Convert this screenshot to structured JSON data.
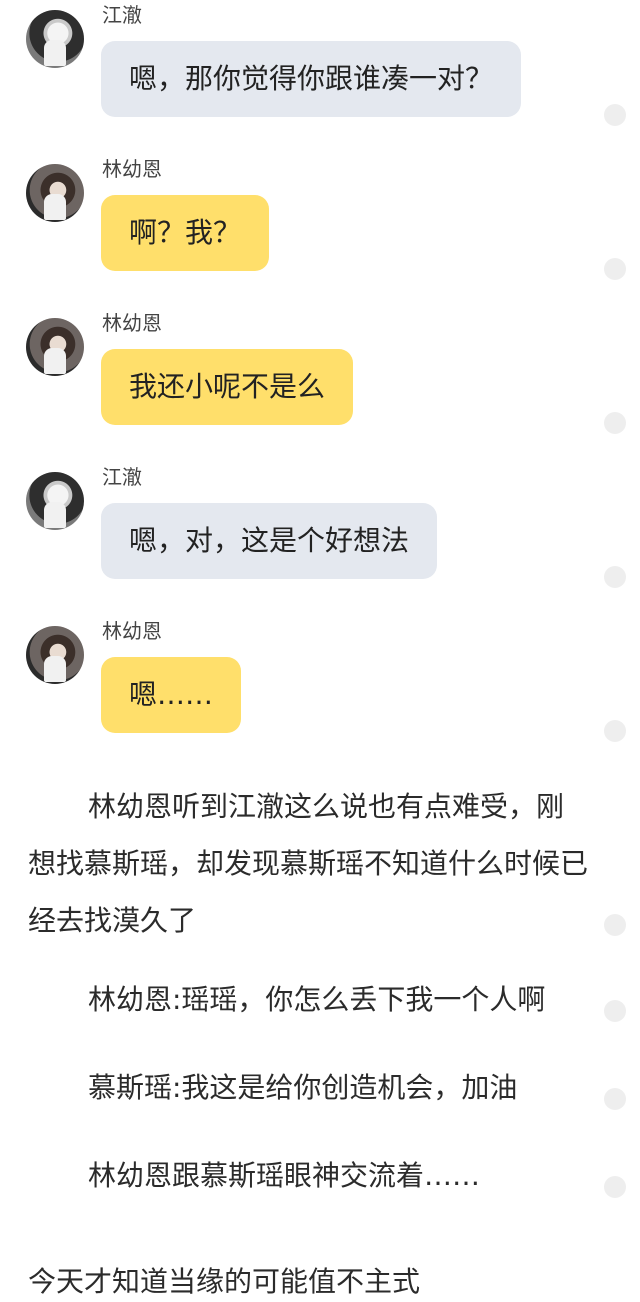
{
  "messages": [
    {
      "sender": "江澈",
      "text": "嗯，那你觉得你跟谁凑一对？",
      "bubble_color": "#e4e8ef"
    },
    {
      "sender": "林幼恩",
      "text": "啊？我？",
      "bubble_color": "#ffdf6b"
    },
    {
      "sender": "林幼恩",
      "text": "我还小呢不是么",
      "bubble_color": "#ffdf6b"
    },
    {
      "sender": "江澈",
      "text": "嗯，对，这是个好想法",
      "bubble_color": "#e4e8ef"
    },
    {
      "sender": "林幼恩",
      "text": "嗯……",
      "bubble_color": "#ffdf6b"
    }
  ],
  "narration": {
    "paragraph": "林幼恩听到江澈这么说也有点难受，刚想找慕斯瑶，却发现慕斯瑶不知道什么时候已经去找漠久了",
    "lines": [
      "林幼恩:瑶瑶，你怎么丢下我一个人啊",
      "慕斯瑶:我这是给你创造机会，加油",
      "林幼恩跟慕斯瑶眼神交流着……"
    ],
    "cut_off_line": "今天才知道当缘的可能值不主式"
  },
  "colors": {
    "gray_bubble": "#e4e8ef",
    "yellow_bubble": "#ffdf6b",
    "side_dot": "#eeeeee"
  }
}
